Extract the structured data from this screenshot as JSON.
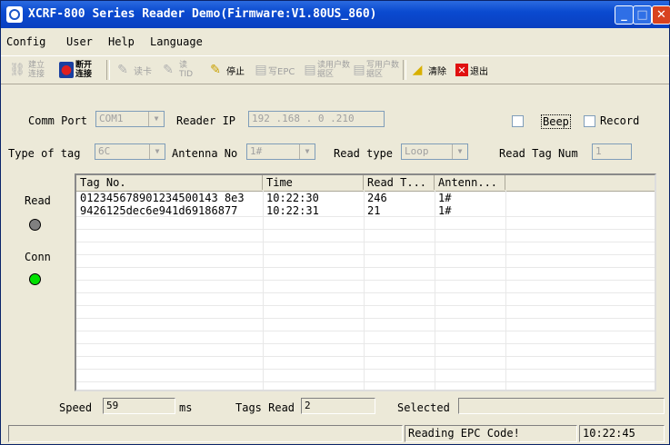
{
  "window": {
    "title": "XCRF-800 Series Reader Demo(Firmware:V1.80US_860)",
    "min_glyph": "_",
    "max_glyph": "□",
    "close_glyph": "✕"
  },
  "menu": [
    "Config",
    "User",
    "Help",
    "Language"
  ],
  "toolbar": {
    "connect": "建立连接",
    "disconnect": "断开连接",
    "read_card": "读卡",
    "read_tid": "读TID",
    "stop": "停止",
    "write_epc": "写EPC",
    "read_user": "读用户数据区",
    "write_user": "写用户数据区",
    "clear": "清除",
    "exit": "退出"
  },
  "settings": {
    "comm_port_label": "Comm Port",
    "comm_port_value": "COM1",
    "reader_ip_label": "Reader IP",
    "reader_ip_value": "192 .168 . 0 .210",
    "beep_label": "Beep",
    "record_label": "Record",
    "type_of_tag_label": "Type of tag",
    "type_of_tag_value": "6C",
    "antenna_no_label": "Antenna No",
    "antenna_no_value": "1#",
    "read_type_label": "Read type",
    "read_type_value": "Loop",
    "read_tag_num_label": "Read Tag Num",
    "read_tag_num_value": "1"
  },
  "indicators": {
    "read_label": "Read",
    "conn_label": "Conn",
    "read_color": "#808080",
    "conn_color": "#00e000"
  },
  "table": {
    "columns": [
      "Tag No.",
      "Time",
      "Read T...",
      "Antenn..."
    ],
    "rows": [
      [
        "012345678901234500143 8e3",
        "10:22:30",
        "246",
        "1#"
      ],
      [
        "9426125dec6e941d69186877",
        "10:22:31",
        "21",
        "1#"
      ]
    ]
  },
  "bottom": {
    "speed_label": "Speed",
    "speed_value": "59",
    "speed_unit": "ms",
    "tags_read_label": "Tags Read",
    "tags_read_value": "2",
    "selected_label": "Selected",
    "selected_value": ""
  },
  "statusbar": {
    "left": "",
    "message": "Reading EPC Code!",
    "time": "10:22:45"
  }
}
